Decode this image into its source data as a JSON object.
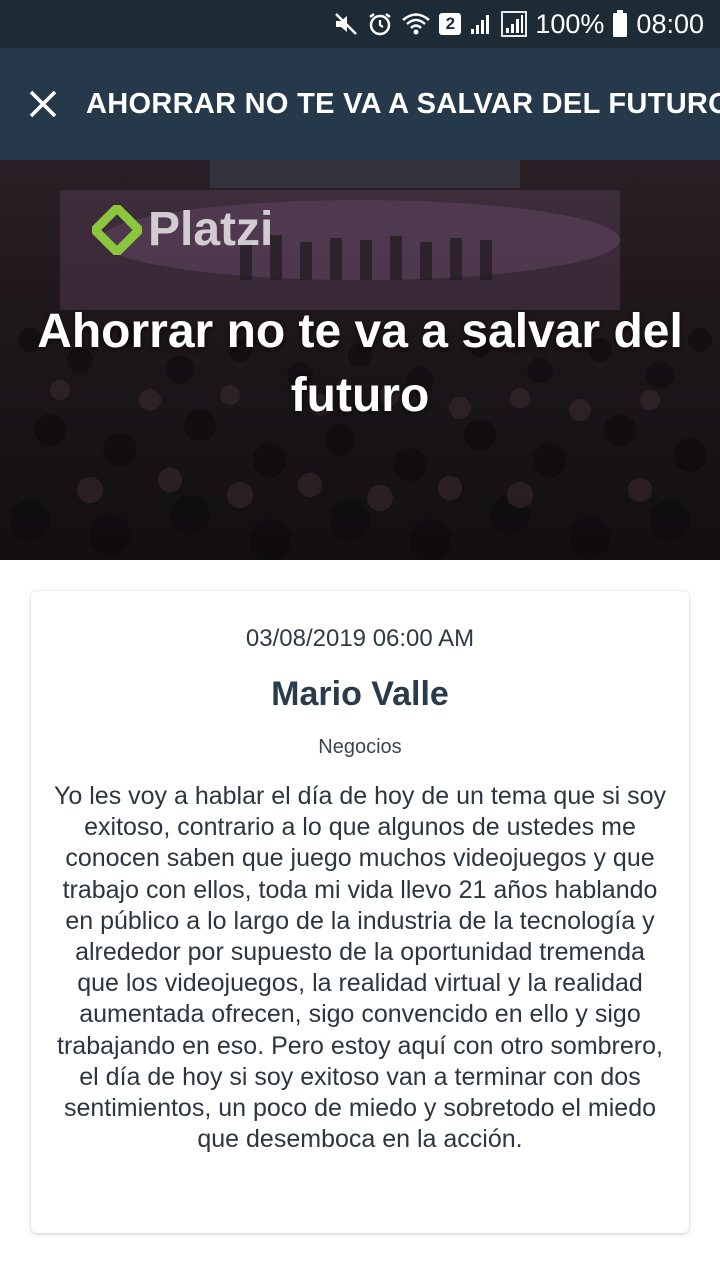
{
  "status_bar": {
    "icons": [
      "mute-icon",
      "alarm-icon",
      "wifi-icon",
      "sim-badge",
      "signal-icon",
      "signal-icon",
      "battery-icon"
    ],
    "sim_badge": "2",
    "battery": "100%",
    "time": "08:00"
  },
  "app_bar": {
    "close_icon": "close-icon",
    "title": "AHORRAR NO TE VA A SALVAR DEL FUTURO"
  },
  "hero": {
    "logo_text": "Platzi",
    "title": "Ahorrar no te va a salvar del futuro"
  },
  "article": {
    "date": "03/08/2019 06:00 AM",
    "author": "Mario Valle",
    "category": "Negocios",
    "body": "Yo les voy a hablar el día de hoy de un tema que si soy exitoso, contrario a lo que algunos de ustedes me conocen saben que juego muchos videojuegos y que trabajo con ellos, toda mi vida llevo 21 años hablando en público a lo largo de la industria de la tecnología y alrededor por supuesto de la oportunidad tremenda que los videojuegos, la realidad virtual y la realidad aumentada ofrecen, sigo convencido en ello y sigo trabajando en eso. Pero estoy aquí con otro sombrero, el día de hoy si soy exitoso van a terminar con dos sentimientos, un poco de miedo y sobretodo el miedo que desemboca en la acción."
  },
  "colors": {
    "status_bar": "#1c2b36",
    "app_bar": "#25394a",
    "author": "#2a3b4b",
    "logo_green": "#8cc63f"
  }
}
